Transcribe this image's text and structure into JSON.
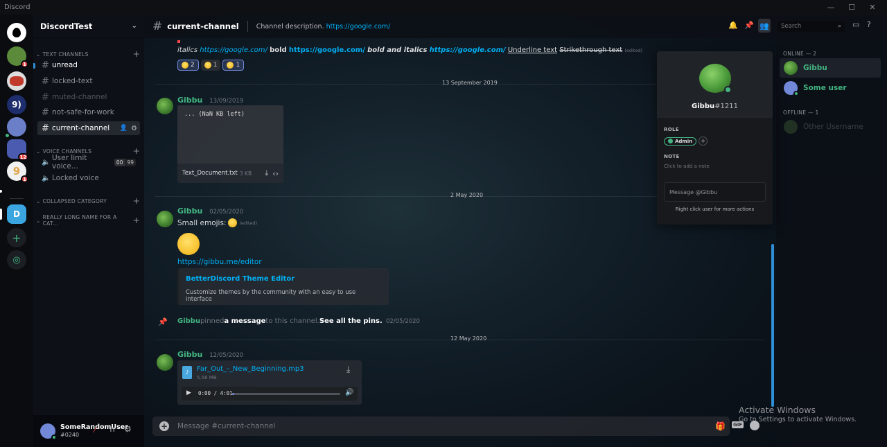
{
  "window": {
    "title": "Discord",
    "controls": [
      "—",
      "☐",
      "✕"
    ]
  },
  "servers": [
    {
      "label": "",
      "badge": "",
      "color": "#ffffff"
    },
    {
      "label": "",
      "badge": "1",
      "color": "#5b8a3a"
    },
    {
      "label": "",
      "badge": "",
      "color": "#c0392b"
    },
    {
      "label": "9)",
      "badge": "",
      "color": "#1e2d6b"
    },
    {
      "label": "",
      "badge": "",
      "color": "#6b7fc8"
    },
    {
      "label": "",
      "badge": "12",
      "color": "#4a5bb0"
    },
    {
      "label": "9",
      "badge": "1",
      "color": "#e9c27a"
    },
    {
      "label": "D",
      "badge": "",
      "color": "#3ba5e0"
    }
  ],
  "guild": {
    "name": "DiscordTest"
  },
  "categories": {
    "text": "TEXT CHANNELS",
    "voice": "VOICE CHANNELS",
    "collapsed": "COLLAPSED CATEGORY",
    "long": "REALLY LONG NAME FOR A CAT..."
  },
  "channels": [
    {
      "name": "unread"
    },
    {
      "name": "locked-text"
    },
    {
      "name": "muted-channel"
    },
    {
      "name": "not-safe-for-work"
    },
    {
      "name": "current-channel"
    }
  ],
  "voice_channels": [
    {
      "name": "User limit voice...",
      "limit_a": "00",
      "limit_b": "99"
    },
    {
      "name": "Locked voice"
    }
  ],
  "user": {
    "name": "SomeRandomUser",
    "tag": "#0240"
  },
  "header": {
    "channel": "current-channel",
    "desc_text": "Channel description.",
    "desc_link": "https://google.com/",
    "search_placeholder": "Search"
  },
  "messages": {
    "format_line": {
      "italics": "italics",
      "link1": "https://google.com/",
      "bold": "bold",
      "link2": "https://google.com/",
      "bold_italics": "bold and italics",
      "link3": "https://google.com/",
      "underline": "Underline text",
      "strike": "Strikethrough text",
      "edited": "(edited)"
    },
    "reactions": [
      {
        "count": "2",
        "me": true
      },
      {
        "count": "1",
        "me": false
      },
      {
        "count": "1",
        "me": true
      }
    ],
    "divider1": "13 September 2019",
    "msg1": {
      "author": "Gibbu",
      "time": "13/09/2019",
      "file_preview": "... (NaN KB left)",
      "file_name": "Text_Document.txt",
      "file_size": "3 KB"
    },
    "divider2": "2 May 2020",
    "msg2": {
      "author": "Gibbu",
      "time": "02/05/2020",
      "text": "Small emojis:",
      "edited": "(edited)",
      "link": "https://gibbu.me/editor",
      "embed_title": "BetterDiscord Theme Editor",
      "embed_desc": "Customize themes by the community with an easy to use interface"
    },
    "pin": {
      "author": "Gibbu",
      "pinned": "pinned",
      "a_message": "a message",
      "to_channel": "to this channel.",
      "see_pins": "See all the pins.",
      "time": "02/05/2020"
    },
    "divider3": "12 May 2020",
    "msg3": {
      "author": "Gibbu",
      "time": "12/05/2020",
      "file_name": "Far_Out_-_New_Beginning.mp3",
      "file_size": "5.56 MB",
      "player_time": "0:00 / 4:01",
      "progress": 0.02
    }
  },
  "members": {
    "online_label": "ONLINE — 2",
    "offline_label": "OFFLINE — 1",
    "list": [
      {
        "name": "Gibbu",
        "color": "#43b581"
      },
      {
        "name": "Some user",
        "color": "#43b581"
      },
      {
        "name": "Other Username",
        "color": "#4f545c"
      }
    ]
  },
  "popout": {
    "username": "Gibbu",
    "discriminator": "#1211",
    "role_title": "ROLE",
    "role": "Admin",
    "note_title": "NOTE",
    "note_placeholder": "Click to add a note",
    "message_placeholder": "Message @Gibbu",
    "hint": "Right click user for more actions"
  },
  "composer": {
    "placeholder": "Message #current-channel",
    "gif": "GIF"
  },
  "watermark": {
    "title": "Activate Windows",
    "subtitle": "Go to Settings to activate Windows."
  }
}
